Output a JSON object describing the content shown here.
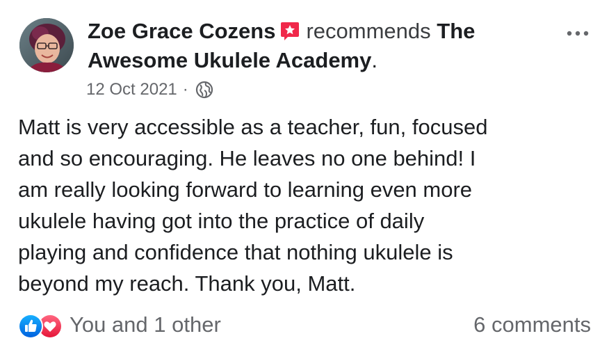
{
  "post": {
    "author": "Zoe Grace Cozens",
    "verb": "recommends",
    "page_name": "The Awesome Ukulele Academy",
    "punctuation": ".",
    "date": "12 Oct 2021",
    "separator": "·",
    "privacy_icon": "globe-icon",
    "recommendation_icon": "recommendation-star-icon",
    "more_icon": "more-options-icon",
    "body_lines": [
      "Matt is very accessible as a teacher, fun, focused",
      "and so encouraging. He leaves no one behind! I",
      "am really looking forward to learning even more",
      "ukulele having got into the practice of daily",
      "playing and confidence that nothing ukulele is",
      "beyond my reach. Thank you, Matt."
    ]
  },
  "footer": {
    "reactions_text": "You and 1 other",
    "reaction_icons": [
      "like-icon",
      "love-icon"
    ],
    "comments_text": "6 comments"
  },
  "colors": {
    "primary_text": "#1c1e21",
    "secondary_text": "#65676b",
    "like_blue": "#1877f2",
    "love_red": "#f33e58",
    "recommend_red": "#f0284a"
  }
}
